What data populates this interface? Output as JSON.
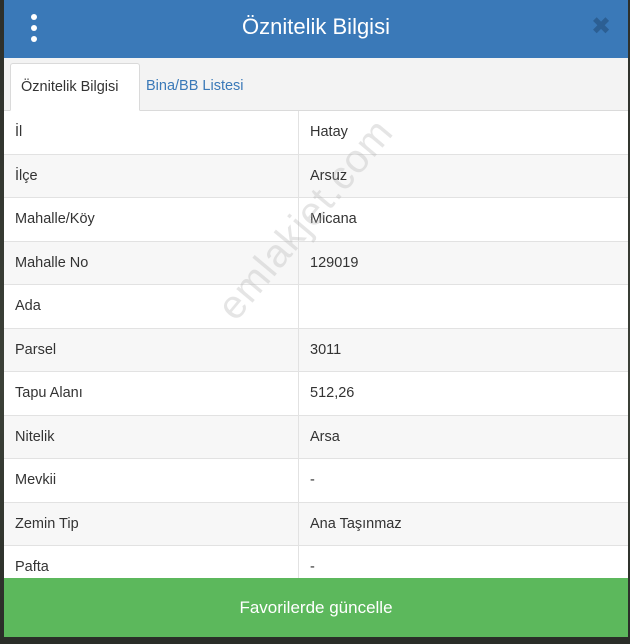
{
  "dialog": {
    "title": "Öznitelik Bilgisi",
    "close_glyph": "✖",
    "menu_icon": "kebab-menu-icon"
  },
  "tabs": [
    {
      "label": "Öznitelik Bilgisi",
      "active": true
    },
    {
      "label": "Bina/BB Listesi",
      "active": false
    }
  ],
  "attributes": [
    {
      "key": "İl",
      "value": "Hatay"
    },
    {
      "key": "İlçe",
      "value": "Arsuz"
    },
    {
      "key": "Mahalle/Köy",
      "value": "Micana"
    },
    {
      "key": "Mahalle No",
      "value": "129019"
    },
    {
      "key": "Ada",
      "value": ""
    },
    {
      "key": "Parsel",
      "value": "3011"
    },
    {
      "key": "Tapu Alanı",
      "value": "512,26"
    },
    {
      "key": "Nitelik",
      "value": "Arsa"
    },
    {
      "key": "Mevkii",
      "value": "-"
    },
    {
      "key": "Zemin Tip",
      "value": "Ana Taşınmaz"
    },
    {
      "key": "Pafta",
      "value": "-"
    }
  ],
  "footer": {
    "button_label": "Favorilerde güncelle"
  },
  "watermark": "emlakjet.com",
  "colors": {
    "header": "#3a79b8",
    "footer_button": "#5cb85c",
    "tab_link": "#3a79b8"
  }
}
